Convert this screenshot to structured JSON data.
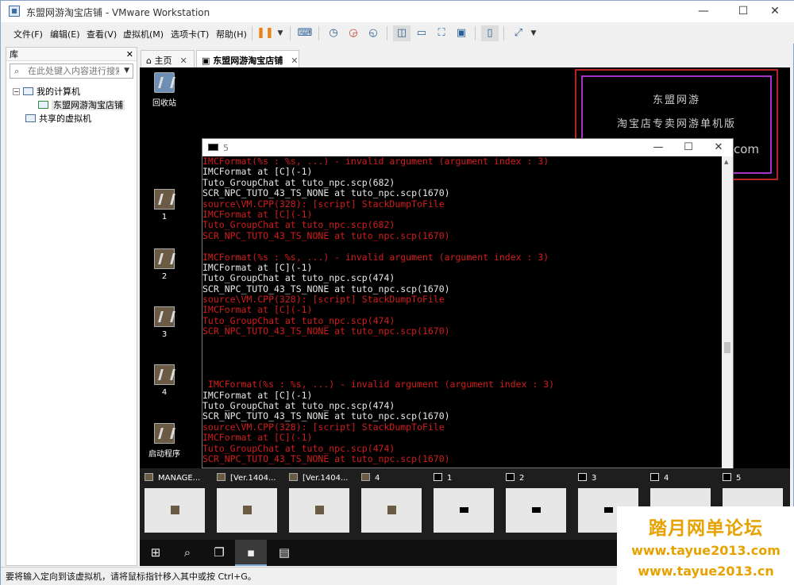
{
  "window": {
    "title": "东盟网游淘宝店铺 - VMware Workstation"
  },
  "menu": [
    "文件(F)",
    "编辑(E)",
    "查看(V)",
    "虚拟机(M)",
    "选项卡(T)",
    "帮助(H)"
  ],
  "library": {
    "title": "库",
    "search_placeholder": "在此处键入内容进行搜索",
    "tree": {
      "root": "我的计算机",
      "vm": "东盟网游淘宝店铺",
      "shared": "共享的虚拟机"
    }
  },
  "tabs": [
    {
      "label": "主页"
    },
    {
      "label": "东盟网游淘宝店铺"
    }
  ],
  "desktop": {
    "icons": [
      "回收站",
      "1",
      "2",
      "3",
      "4",
      "启动程序"
    ],
    "promo": {
      "line1": "东盟网游",
      "line2": "淘宝店专卖网游单机版",
      "line3": "com"
    }
  },
  "console": {
    "title": "5",
    "lines": [
      {
        "t": "IMCFormat(%s : %s, ...) - invalid argument (argument index : 3)",
        "c": "r"
      },
      {
        "t": "IMCFormat at [C](-1)",
        "c": "w"
      },
      {
        "t": "Tuto_GroupChat at tuto_npc.scp(682)",
        "c": "w"
      },
      {
        "t": "SCR_NPC_TUTO_43_TS_NONE at tuto_npc.scp(1670)",
        "c": "w"
      },
      {
        "t": "source\\VM.CPP(328): [script] StackDumpToFile",
        "c": "r"
      },
      {
        "t": "IMCFormat at [C](-1)",
        "c": "r"
      },
      {
        "t": "Tuto_GroupChat at tuto_npc.scp(682)",
        "c": "r"
      },
      {
        "t": "SCR_NPC_TUTO_43_TS_NONE at tuto_npc.scp(1670)",
        "c": "r"
      },
      {
        "t": "",
        "c": "w"
      },
      {
        "t": "IMCFormat(%s : %s, ...) - invalid argument (argument index : 3)",
        "c": "r"
      },
      {
        "t": "IMCFormat at [C](-1)",
        "c": "w"
      },
      {
        "t": "Tuto_GroupChat at tuto_npc.scp(474)",
        "c": "w"
      },
      {
        "t": "SCR_NPC_TUTO_43_TS_NONE at tuto_npc.scp(1670)",
        "c": "w"
      },
      {
        "t": "source\\VM.CPP(328): [script] StackDumpToFile",
        "c": "r"
      },
      {
        "t": "IMCFormat at [C](-1)",
        "c": "r"
      },
      {
        "t": "Tuto_GroupChat at tuto_npc.scp(474)",
        "c": "r"
      },
      {
        "t": "SCR_NPC_TUTO_43_TS_NONE at tuto_npc.scp(1670)",
        "c": "r"
      },
      {
        "t": "",
        "c": "w"
      },
      {
        "t": "",
        "c": "w"
      },
      {
        "t": "",
        "c": "w"
      },
      {
        "t": "",
        "c": "w"
      },
      {
        "t": " IMCFormat(%s : %s, ...) - invalid argument (argument index : 3)",
        "c": "r"
      },
      {
        "t": "IMCFormat at [C](-1)",
        "c": "w"
      },
      {
        "t": "Tuto_GroupChat at tuto_npc.scp(474)",
        "c": "w"
      },
      {
        "t": "SCR_NPC_TUTO_43_TS_NONE at tuto_npc.scp(1670)",
        "c": "w"
      },
      {
        "t": "source\\VM.CPP(328): [script] StackDumpToFile",
        "c": "r"
      },
      {
        "t": "IMCFormat at [C](-1)",
        "c": "r"
      },
      {
        "t": "Tuto_GroupChat at tuto_npc.scp(474)",
        "c": "r"
      },
      {
        "t": "SCR_NPC_TUTO_43_TS_NONE at tuto_npc.scp(1670)",
        "c": "r"
      }
    ]
  },
  "thumbnails": [
    {
      "label": "MANAGE...",
      "type": "app"
    },
    {
      "label": "[Ver.1404...",
      "type": "app"
    },
    {
      "label": "[Ver.1404...",
      "type": "app"
    },
    {
      "label": "4",
      "type": "app"
    },
    {
      "label": "1",
      "type": "cmd"
    },
    {
      "label": "2",
      "type": "cmd"
    },
    {
      "label": "3",
      "type": "cmd"
    },
    {
      "label": "4",
      "type": "cmd"
    },
    {
      "label": "5",
      "type": "cmd"
    }
  ],
  "status": "要将输入定向到该虚拟机，请将鼠标指针移入其中或按 Ctrl+G。",
  "watermark": {
    "line1": "踏月网单论坛",
    "line2": "www.tayue2013.com",
    "line3": "www.tayue2013.cn"
  },
  "colors": {
    "error_text": "#d21d1d",
    "normal_text": "#e8e8e8",
    "watermark": "#e8a200"
  }
}
